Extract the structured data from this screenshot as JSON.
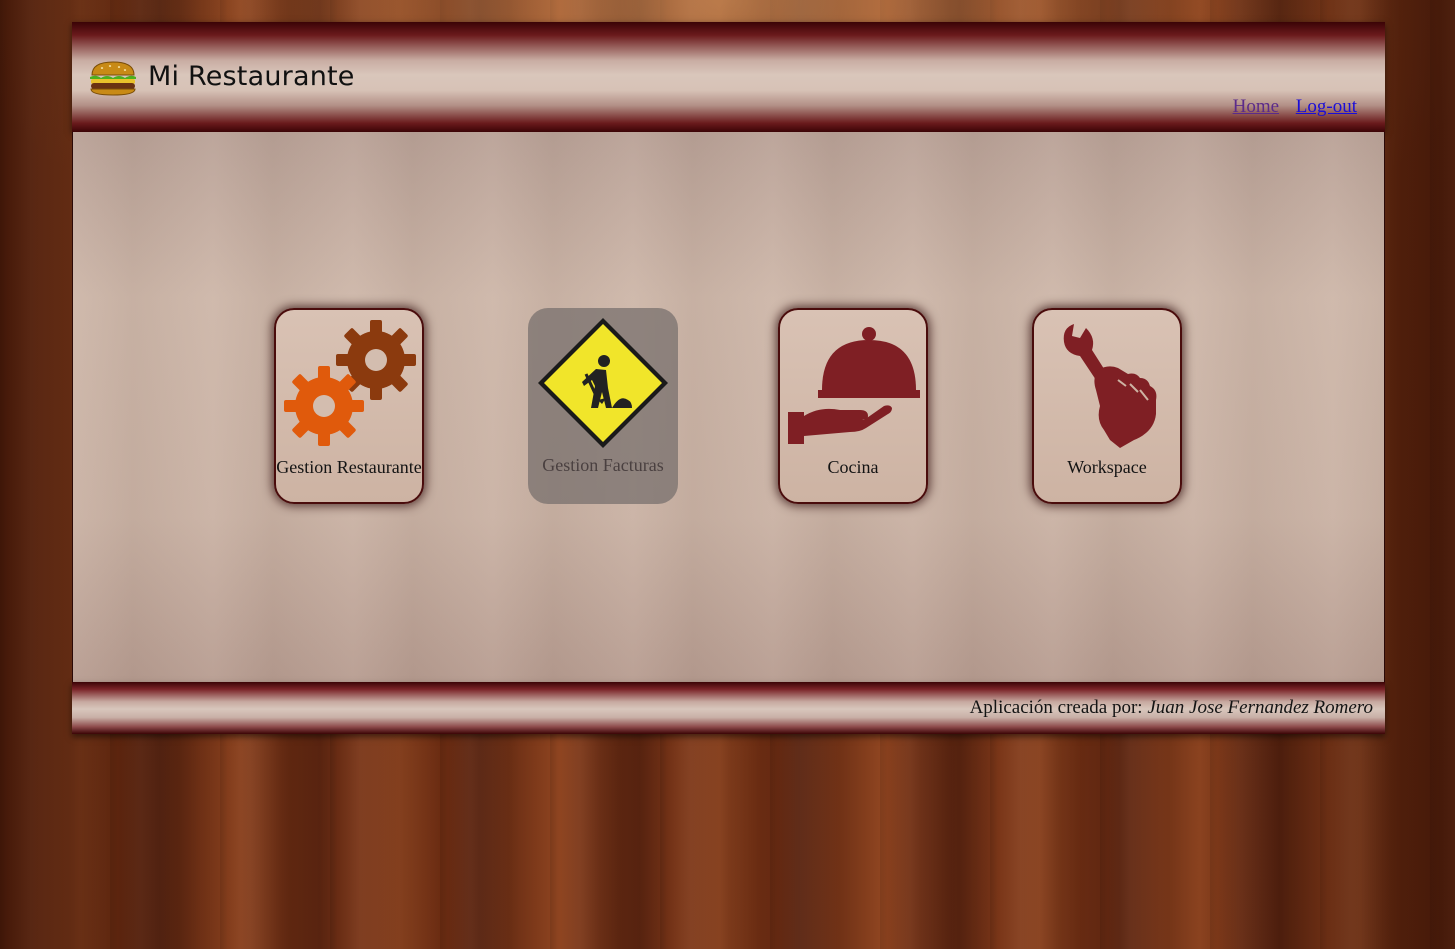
{
  "header": {
    "site_title": "Mi Restaurante",
    "logo_icon": "hamburger-icon",
    "nav": [
      {
        "label": "Home",
        "state": "visited"
      },
      {
        "label": "Log-out",
        "state": "link"
      }
    ]
  },
  "tiles": [
    {
      "label": "Gestion Restaurante",
      "icon": "gears-icon",
      "enabled": true
    },
    {
      "label": "Gestion Facturas",
      "icon": "under-construction-icon",
      "enabled": false
    },
    {
      "label": "Cocina",
      "icon": "serving-cloche-icon",
      "enabled": true
    },
    {
      "label": "Workspace",
      "icon": "wrench-hand-icon",
      "enabled": true
    }
  ],
  "footer": {
    "credit_prefix": "Aplicación creada por: ",
    "credit_author": "Juan Jose Fernandez Romero"
  },
  "colors": {
    "header_dark": "#3a0306",
    "icon_red": "#7f1f24",
    "gear_orange": "#e05a0c",
    "gear_brown": "#8b3a0e",
    "sign_yellow": "#f1e52a"
  }
}
